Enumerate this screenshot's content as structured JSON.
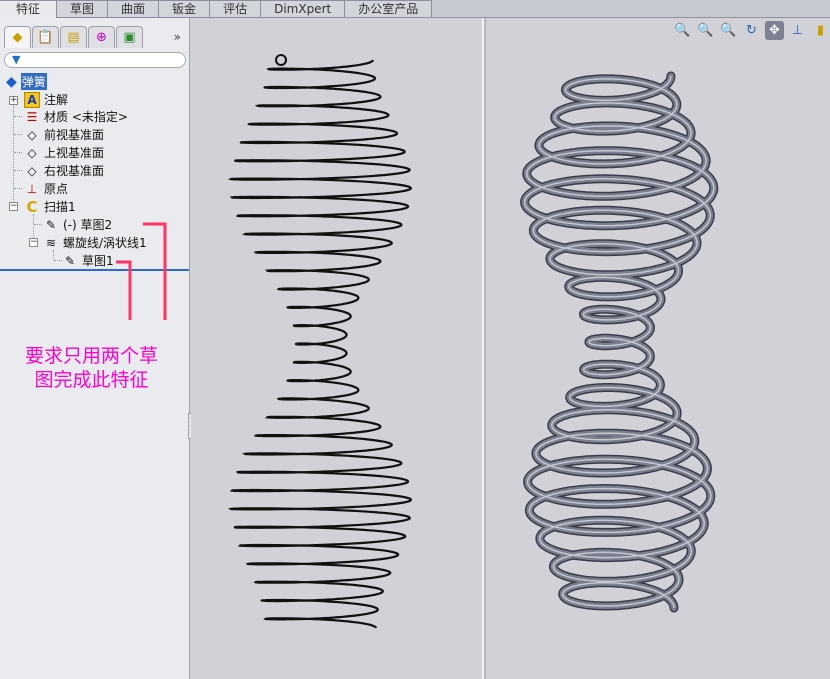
{
  "tabs": [
    "特征",
    "草图",
    "曲面",
    "钣金",
    "评估",
    "DimXpert",
    "办公室产品"
  ],
  "active_tab": "特征",
  "panel": {
    "tabs": [
      {
        "icon": "feature-manager-icon"
      },
      {
        "icon": "property-manager-icon"
      },
      {
        "icon": "configuration-manager-icon"
      },
      {
        "icon": "dimxpert-manager-icon"
      },
      {
        "icon": "display-manager-icon"
      }
    ],
    "more": "»",
    "root": "弹簧",
    "tree": [
      {
        "label": "注解",
        "icon": "annotations-icon"
      },
      {
        "label": "材质 <未指定>",
        "icon": "material-icon"
      },
      {
        "label": "前视基准面",
        "icon": "plane-icon"
      },
      {
        "label": "上视基准面",
        "icon": "plane-icon"
      },
      {
        "label": "右视基准面",
        "icon": "plane-icon"
      },
      {
        "label": "原点",
        "icon": "origin-icon"
      },
      {
        "label": "扫描1",
        "icon": "sweep-icon"
      },
      {
        "label": "(-) 草图2",
        "icon": "sketch-icon"
      },
      {
        "label": "螺旋线/涡状线1",
        "icon": "helix-icon"
      },
      {
        "label": "草图1",
        "icon": "sketch-icon"
      }
    ]
  },
  "annotation": {
    "line1": "要求只用两个草",
    "line2": "图完成此特征",
    "color": "#ff00cc",
    "leader_color": "#ff3366"
  },
  "view_tools": [
    {
      "icon": "zoom-to-fit-icon"
    },
    {
      "icon": "zoom-to-area-icon"
    },
    {
      "icon": "zoom-in-out-icon"
    },
    {
      "icon": "rotate-icon"
    },
    {
      "icon": "pan-icon",
      "active": true
    },
    {
      "icon": "normal-to-icon"
    },
    {
      "icon": "view-orientation-icon"
    }
  ],
  "colors": {
    "spring_tube": "#5d6170",
    "selection": "#3169c6"
  }
}
